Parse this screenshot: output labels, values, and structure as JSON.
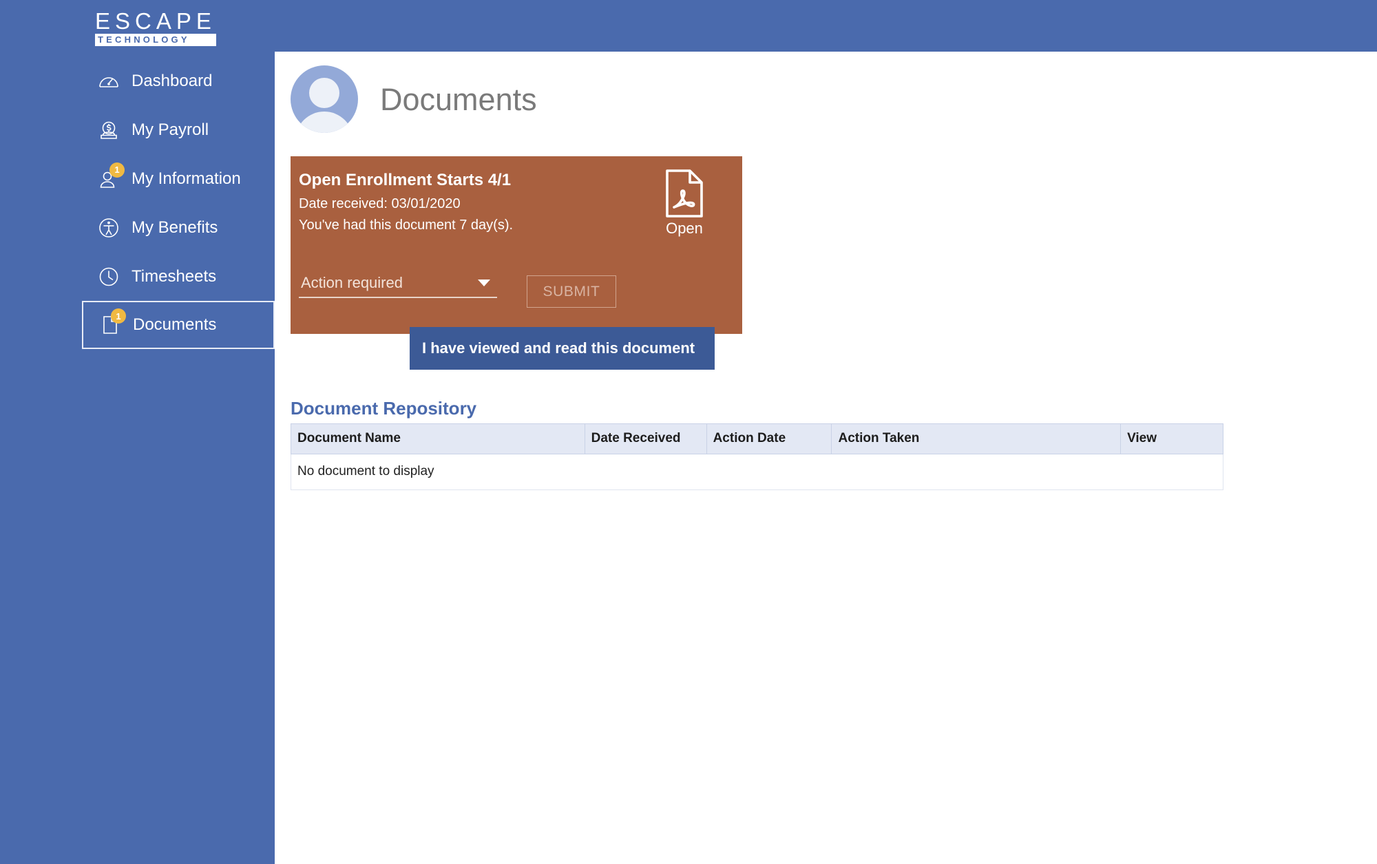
{
  "brand": {
    "logo_primary": "ESCAPE",
    "logo_secondary": "TECHNOLOGY",
    "sidebar_color": "#4a6aad",
    "accent_color": "#a9603f",
    "badge_color": "#f0b942"
  },
  "sidebar": {
    "items": [
      {
        "label": "Dashboard",
        "icon": "gauge-icon",
        "badge": null,
        "selected": false
      },
      {
        "label": "My Payroll",
        "icon": "money-bag-icon",
        "badge": null,
        "selected": false
      },
      {
        "label": "My Information",
        "icon": "user-icon",
        "badge": "1",
        "selected": false
      },
      {
        "label": "My Benefits",
        "icon": "accessibility-icon",
        "badge": null,
        "selected": false
      },
      {
        "label": "Timesheets",
        "icon": "clock-icon",
        "badge": null,
        "selected": false
      },
      {
        "label": "Documents",
        "icon": "document-icon",
        "badge": "1",
        "selected": true
      }
    ]
  },
  "header": {
    "title": "Documents",
    "avatar": "user-avatar"
  },
  "document_card": {
    "title": "Open Enrollment Starts 4/1",
    "date_received": "Date received: 03/01/2020",
    "days_held": "You've had this document 7 day(s).",
    "open_label": "Open",
    "open_icon": "pdf-file-icon",
    "action_select_value": "Action required",
    "submit_label": "SUBMIT"
  },
  "dropdown": {
    "options": [
      {
        "label": "I have viewed and read this document",
        "highlighted": true
      }
    ]
  },
  "repository": {
    "title": "Document Repository",
    "columns": [
      "Document Name",
      "Date Received",
      "Action Date",
      "Action Taken",
      "View"
    ],
    "rows": [],
    "empty_message": "No document to display"
  }
}
